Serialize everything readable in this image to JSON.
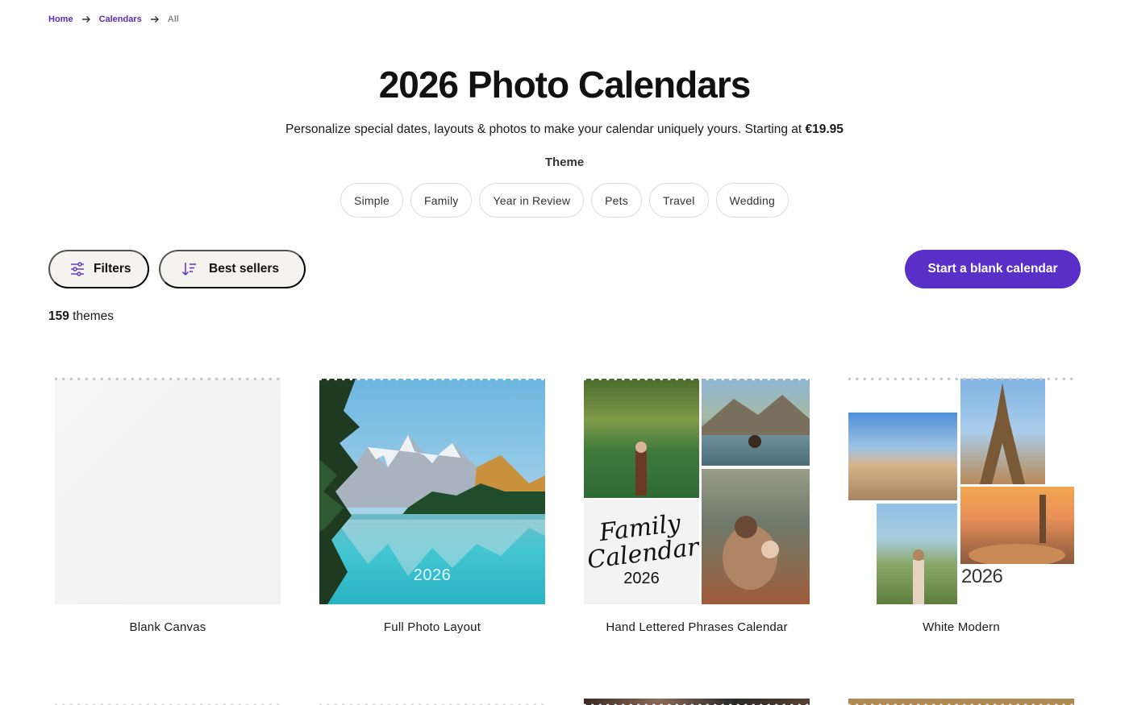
{
  "breadcrumb": {
    "home": "Home",
    "calendars": "Calendars",
    "current": "All"
  },
  "header": {
    "title": "2026 Photo Calendars",
    "subtitle_text": "Personalize special dates, layouts & photos to make your calendar uniquely yours. Starting at ",
    "subtitle_price": "€19.95",
    "theme_label": "Theme"
  },
  "themes": [
    "Simple",
    "Family",
    "Year in Review",
    "Pets",
    "Travel",
    "Wedding"
  ],
  "toolbar": {
    "filters_label": "Filters",
    "sort_label": "Best sellers",
    "cta_label": "Start a blank calendar"
  },
  "results": {
    "count": "159",
    "suffix": " themes"
  },
  "products": [
    {
      "title": "Blank Canvas"
    },
    {
      "title": "Full Photo Layout",
      "year": "2026"
    },
    {
      "title": "Hand Lettered Phrases Calendar",
      "lettering": "Family Calendar",
      "year": "2026"
    },
    {
      "title": "White Modern",
      "year": "2026"
    }
  ],
  "colors": {
    "accent": "#5a2fc7",
    "link": "#5b2bbf",
    "pill_bg": "#f4f3ef"
  }
}
